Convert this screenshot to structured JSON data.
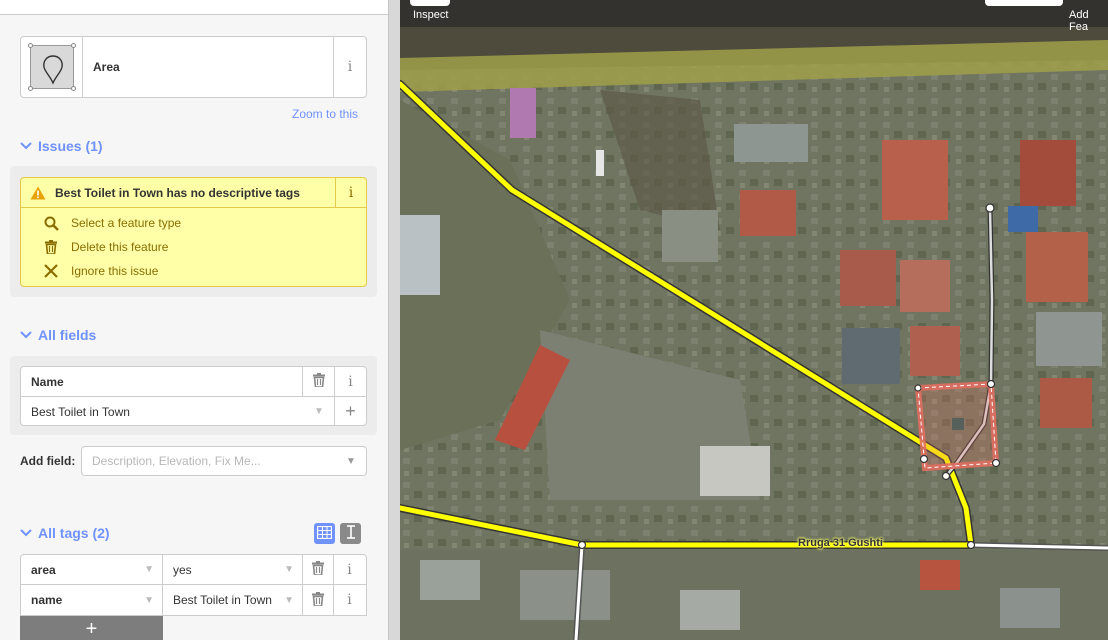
{
  "preset": {
    "name": "Area",
    "icon": "area-preset-icon",
    "info_glyph": "i"
  },
  "zoom_link": "Zoom to this",
  "issues": {
    "header": "Issues (1)",
    "items": [
      {
        "message": "Best Toilet in Town has no descriptive tags",
        "info_glyph": "i",
        "fixes": [
          {
            "label": "Select a feature type",
            "icon": "search-icon"
          },
          {
            "label": "Delete this feature",
            "icon": "trash-icon"
          },
          {
            "label": "Ignore this issue",
            "icon": "close-icon"
          }
        ]
      }
    ]
  },
  "fields": {
    "header": "All fields",
    "name_field": {
      "label": "Name",
      "value": "Best Toilet in Town",
      "info_glyph": "i",
      "add_glyph": "+"
    },
    "add_field_label": "Add field:",
    "add_field_placeholder": "Description, Elevation, Fix Me..."
  },
  "tags": {
    "header": "All tags (2)",
    "rows": [
      {
        "key": "area",
        "value": "yes"
      },
      {
        "key": "name",
        "value": "Best Toilet in Town"
      }
    ],
    "info_glyph": "i",
    "add_glyph": "+"
  },
  "map": {
    "top_left_label": "Inspect",
    "top_right_label": "Add Fea",
    "road_label": "Rruga 31 Gushti"
  },
  "colors": {
    "accent": "#7092ff",
    "issue_bg": "#ffffa8",
    "issue_text": "#8a6d00",
    "road": "#ffff00",
    "area_outline": "#e06e5f"
  }
}
